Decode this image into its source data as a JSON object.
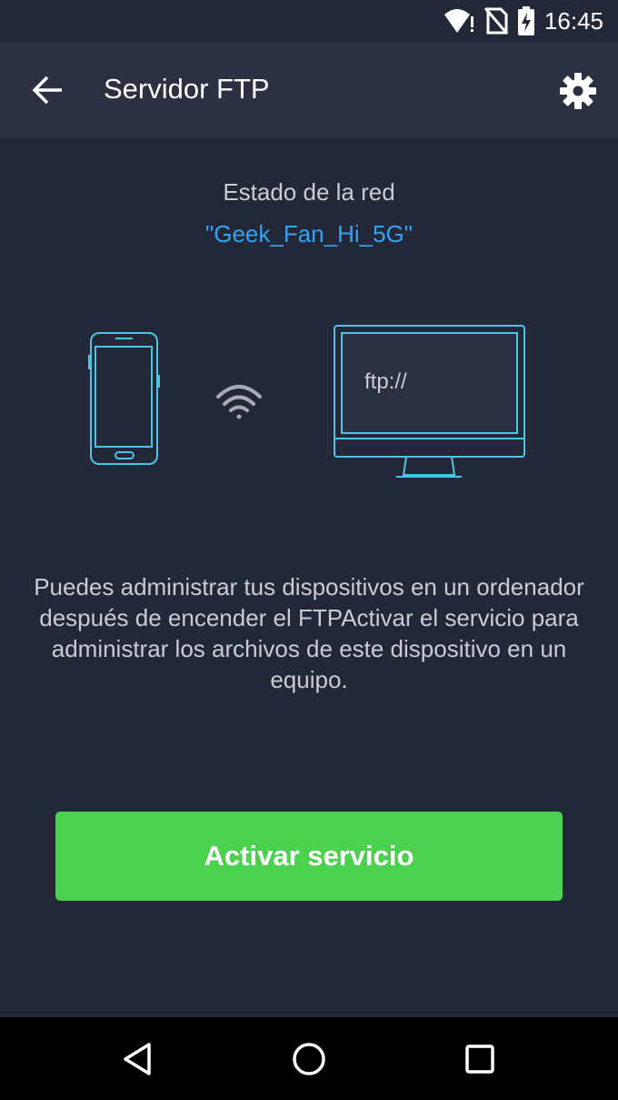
{
  "status_bar": {
    "time": "16:45",
    "icons": [
      "wifi-alert-icon",
      "no-sim-icon",
      "battery-charging-icon"
    ]
  },
  "app_bar": {
    "title": "Servidor FTP",
    "back_icon": "arrow-left-icon",
    "settings_icon": "gear-icon"
  },
  "network": {
    "label": "Estado de la red",
    "name": "\"Geek_Fan_Hi_5G\""
  },
  "illustration": {
    "monitor_text": "ftp://"
  },
  "description": "Puedes administrar tus dispositivos en un ordenador después de encender el FTPActivar el servicio para administrar los archivos de este dispositivo en un equipo.",
  "activate_button": "Activar servicio",
  "colors": {
    "background": "#232838",
    "app_bar": "#2b3142",
    "accent_blue": "#33a3f4",
    "button_green": "#4cd050",
    "device_outline": "#4fc3e6"
  },
  "nav_bar": {
    "icons": [
      "back-triangle-icon",
      "home-circle-icon",
      "recents-square-icon"
    ]
  }
}
